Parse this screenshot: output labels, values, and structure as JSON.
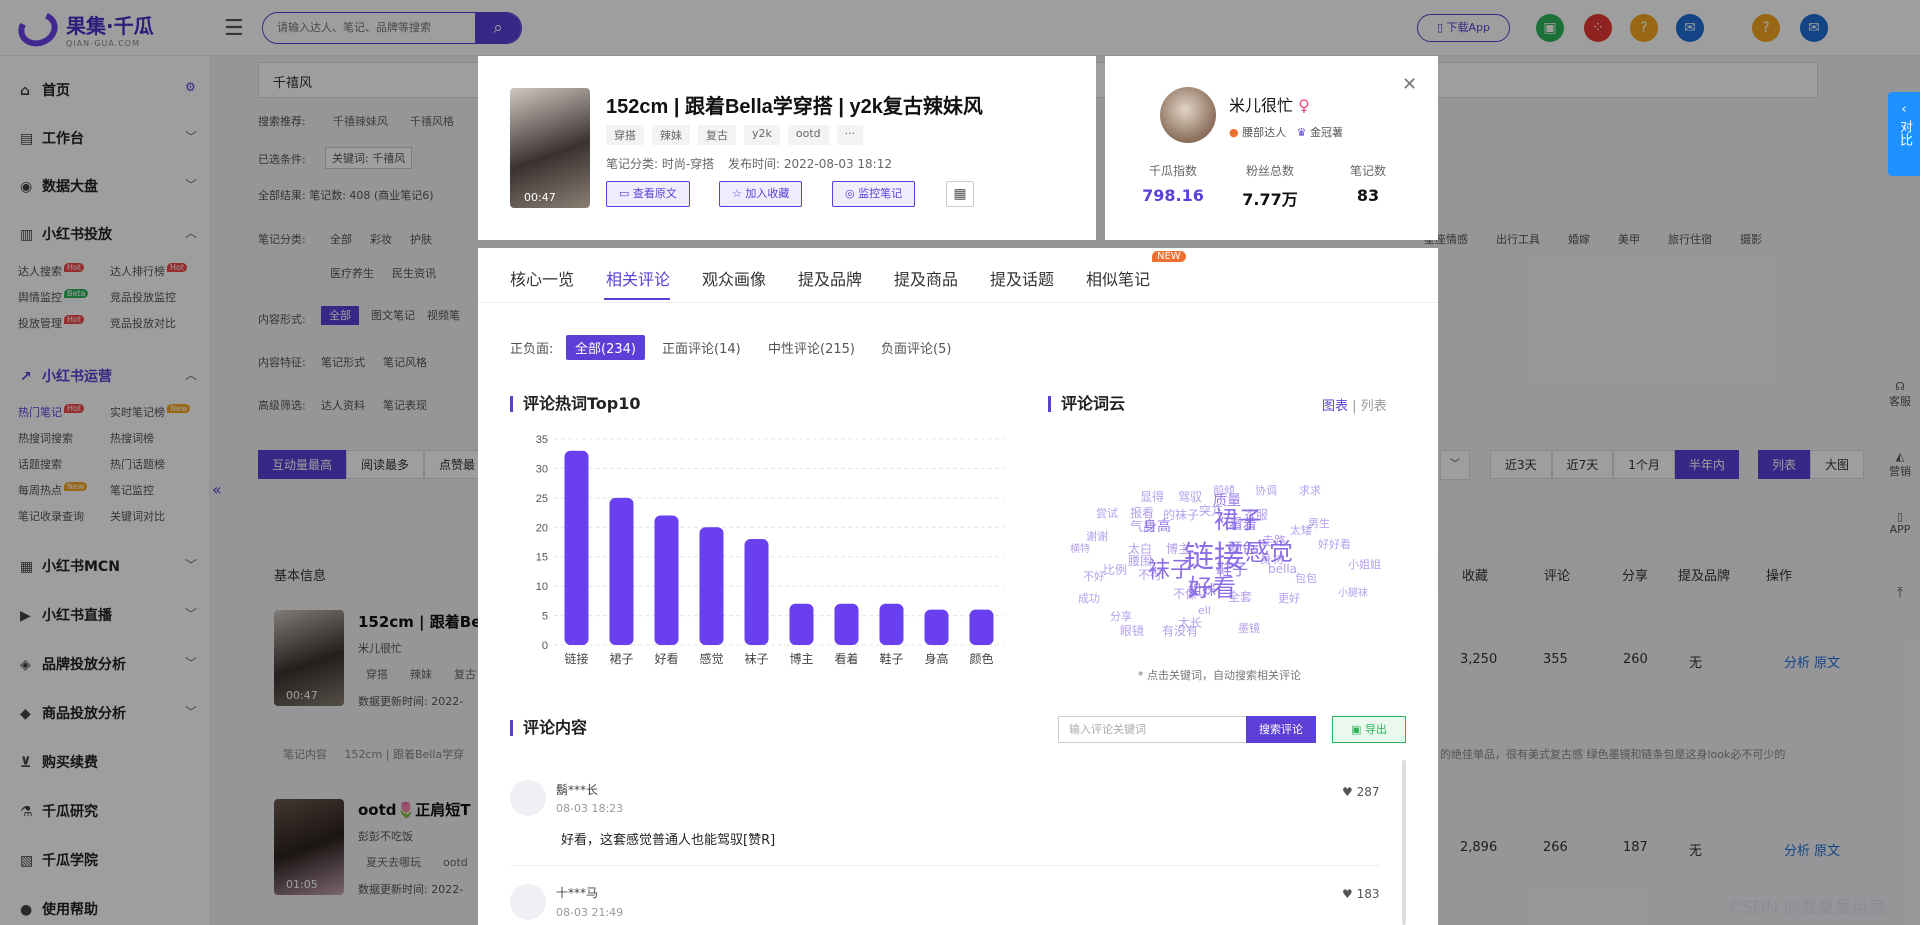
{
  "app": {
    "logo_main": "果集·千瓜",
    "logo_sub": "QIAN-GUA.COM",
    "search_placeholder": "请输入达人、笔记、品牌等搜索",
    "download_app": "下载App"
  },
  "sidebar": {
    "home": "首页",
    "workbench": "工作台",
    "dashboard": "数据大盘",
    "xhs_ads": "小红书投放",
    "ads_items": [
      {
        "label": "达人搜索",
        "badge": "Hot"
      },
      {
        "label": "达人排行榜",
        "badge": "Hot"
      },
      {
        "label": "舆情监控",
        "badge": "Beta"
      },
      {
        "label": "竞品投放监控",
        "badge": ""
      },
      {
        "label": "投放管理",
        "badge": "Hot"
      },
      {
        "label": "竞品投放对比",
        "badge": ""
      }
    ],
    "xhs_ops": "小红书运营",
    "ops_items": [
      {
        "label": "热门笔记",
        "badge": "Hot"
      },
      {
        "label": "实时笔记榜",
        "badge": "New"
      },
      {
        "label": "热搜词搜索",
        "badge": ""
      },
      {
        "label": "热搜词榜",
        "badge": ""
      },
      {
        "label": "话题搜索",
        "badge": ""
      },
      {
        "label": "热门话题榜",
        "badge": ""
      },
      {
        "label": "每周热点",
        "badge": "New"
      },
      {
        "label": "笔记监控",
        "badge": ""
      },
      {
        "label": "笔记收录查询",
        "badge": ""
      },
      {
        "label": "关键词对比",
        "badge": ""
      }
    ],
    "mcn": "小红书MCN",
    "live": "小红书直播",
    "brand": "品牌投放分析",
    "goods": "商品投放分析",
    "renew": "购买续费",
    "research": "千瓜研究",
    "academy": "千瓜学院",
    "help": "使用帮助"
  },
  "background": {
    "search_value": "千禧风",
    "rec_label": "搜索推荐:",
    "rec_tags": [
      "千禧辣妹风",
      "千禧风格"
    ],
    "selected_label": "已选条件:",
    "selected_value": "关键词: 千禧风",
    "result_label": "全部结果:",
    "result_value": "笔记数: 408 (商业笔记6)",
    "cat_label": "笔记分类:",
    "cat_tags": [
      "全部",
      "彩妆",
      "护肤"
    ],
    "cat_tags2": [
      "医疗养生",
      "民生资讯"
    ],
    "right_cats": [
      "星座情感",
      "出行工具",
      "婚嫁",
      "美甲",
      "旅行住宿",
      "摄影"
    ],
    "form_label": "内容形式:",
    "form_tags": [
      "全部",
      "图文笔记",
      "视频笔"
    ],
    "feature_label": "内容特征:",
    "feature_tags": [
      "笔记形式",
      "笔记风格"
    ],
    "adv_label": "高级筛选:",
    "adv_tags": [
      "达人资料",
      "笔记表现"
    ],
    "sort_tabs": [
      "互动量最高",
      "阅读最多",
      "点赞最"
    ],
    "range_tabs": [
      "近3天",
      "近7天",
      "1个月",
      "半年内"
    ],
    "view_tabs": [
      "列表",
      "大图"
    ],
    "table_headers": [
      "基本信息",
      "收藏",
      "评论",
      "分享",
      "提及品牌",
      "操作"
    ],
    "rows": [
      {
        "title": "152cm | 跟着Bella",
        "author": "米儿很忙",
        "tags": [
          "穿搭",
          "辣妹",
          "复古"
        ],
        "updated": "数据更新时间: 2022-",
        "duration": "00:47",
        "fav": "3,250",
        "comment": "355",
        "share": "260",
        "brand": "无",
        "op1": "分析",
        "op2": "原文"
      },
      {
        "title": "ootd🌷正肩短T",
        "author": "彭彭不吃饭",
        "tags": [
          "夏天去哪玩",
          "ootd"
        ],
        "updated": "数据更新时间: 2022-",
        "duration": "01:05",
        "fav": "2,896",
        "comment": "266",
        "share": "187",
        "brand": "无",
        "op1": "分析",
        "op2": "原文"
      }
    ],
    "note_content_label": "笔记内容",
    "note_content_value": "152cm | 跟着Bella学穿",
    "note_content_tail": "的绝佳单品，很有美式复古感 绿色墨镜和链条包是这身look必不可少的"
  },
  "modal": {
    "duration": "00:47",
    "title": "152cm | 跟着Bella学穿搭 | y2k复古辣妹风",
    "tags": [
      "穿搭",
      "辣妹",
      "复古",
      "y2k",
      "ootd",
      "···"
    ],
    "category": "笔记分类: 时尚-穿搭",
    "publish": "发布时间: 2022-08-03 18:12",
    "btn_view": "查看原文",
    "btn_fav": "加入收藏",
    "btn_monitor": "监控笔记",
    "author": {
      "name": "米儿很忙",
      "gender": "♀",
      "level": "腰部达人",
      "badge": "金冠薯",
      "stats": [
        {
          "label": "千瓜指数",
          "value": "798.16"
        },
        {
          "label": "粉丝总数",
          "value": "7.77万"
        },
        {
          "label": "笔记数",
          "value": "83"
        }
      ]
    },
    "tabs": [
      "核心一览",
      "相关评论",
      "观众画像",
      "提及品牌",
      "提及商品",
      "提及话题",
      "相似笔记"
    ],
    "tab_new": "NEW",
    "sentiment_label": "正负面:",
    "sentiments": [
      "全部(234)",
      "正面评论(14)",
      "中性评论(215)",
      "负面评论(5)"
    ],
    "hotwords_title": "评论热词Top10",
    "cloud_title": "评论词云",
    "cloud_view": "图表",
    "cloud_list": "列表",
    "cloud_note": "* 点击关键词，自动搜索相关评论",
    "comments_title": "评论内容",
    "comment_placeholder": "输入评论关键词",
    "comment_search": "搜索评论",
    "export": "导出",
    "comments": [
      {
        "user": "鬍***长",
        "time": "08-03 18:23",
        "text": "好看，这套感觉普通人也能驾驭[赞R]",
        "likes": "287"
      },
      {
        "user": "十***马",
        "time": "08-03 21:49",
        "text": "",
        "likes": "183"
      }
    ]
  },
  "chart_data": {
    "type": "bar",
    "title": "评论热词Top10",
    "categories": [
      "链接",
      "裙子",
      "好看",
      "感觉",
      "袜子",
      "博主",
      "看着",
      "鞋子",
      "身高",
      "颜色"
    ],
    "values": [
      33,
      25,
      22,
      20,
      18,
      7,
      7,
      7,
      6,
      6
    ],
    "ylim": [
      0,
      35
    ],
    "yticks": [
      0,
      5,
      10,
      15,
      20,
      25,
      30,
      35
    ],
    "grid": true,
    "color": "#6a3ff0"
  },
  "wordcloud": [
    "链接",
    "裙子",
    "感觉",
    "袜子",
    "好看",
    "博主",
    "质量",
    "鞋子",
    "看着",
    "衣服",
    "颜色",
    "身高",
    "腰围",
    "气质",
    "太白",
    "比例",
    "不行",
    "不像",
    "姐妹",
    "全套",
    "太长",
    "bella",
    "更好",
    "墨镜",
    "眼镜",
    "有没有",
    "分享",
    "成功",
    "不好",
    "横特",
    "谢谢",
    "尝试",
    "报看",
    "的袜子",
    "突兀",
    "显得",
    "驾驭",
    "前倾",
    "协调",
    "求求",
    "太矮",
    "男生",
    "走路",
    "身材",
    "好好看",
    "包包",
    "小姐姐",
    "小腿袜",
    "ell"
  ],
  "right_float": {
    "compare": "对比",
    "tools": [
      "客服",
      "营销",
      "APP"
    ]
  },
  "watermark": "CSDN @夏夏爱运营"
}
